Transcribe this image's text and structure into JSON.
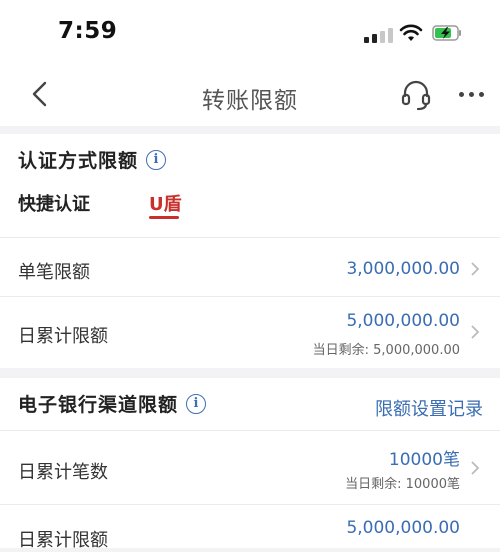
{
  "status_bar": {
    "time": "7:59"
  },
  "nav": {
    "title": "转账限额"
  },
  "auth_section": {
    "title": "认证方式限额",
    "info_glyph": "i",
    "tabs": [
      {
        "label": "快捷认证",
        "selected": false
      },
      {
        "label": "U盾",
        "selected": true
      }
    ],
    "rows": [
      {
        "label": "单笔限额",
        "value": "3,000,000.00"
      },
      {
        "label": "日累计限额",
        "value": "5,000,000.00",
        "sub": "当日剩余: 5,000,000.00"
      }
    ]
  },
  "channel_section": {
    "title": "电子银行渠道限额",
    "info_glyph": "i",
    "link": "限额设置记录",
    "rows": [
      {
        "label": "日累计笔数",
        "value": "10000笔",
        "sub": "当日剩余: 10000笔"
      },
      {
        "label": "日累计限额",
        "value": "5,000,000.00"
      }
    ]
  },
  "colors": {
    "accent_blue": "#3a6db3",
    "brand_red": "#c9302c",
    "background": "#f3f3f5"
  }
}
